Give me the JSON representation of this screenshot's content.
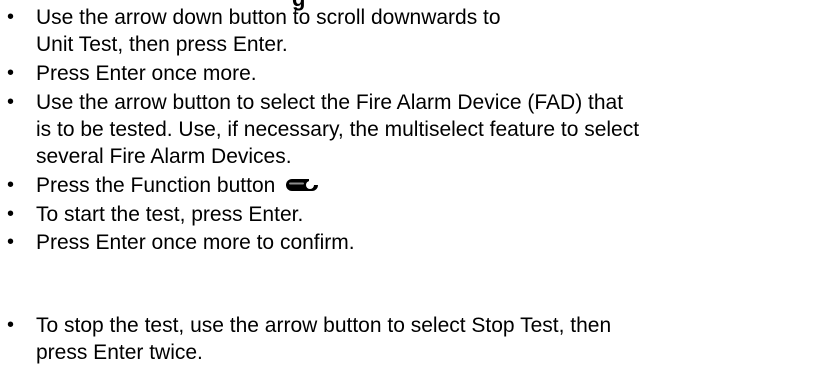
{
  "header_partial": "g",
  "steps": [
    {
      "lines": [
        "Use the arrow down button to scroll downwards to",
        "Unit Test, then press Enter."
      ]
    },
    {
      "lines": [
        "Press Enter once more."
      ]
    },
    {
      "lines": [
        "Use the arrow button to select  the Fire Alarm Device (FAD) that",
        "is to be tested. Use, if necessary, the multiselect feature to select",
        "several Fire Alarm Devices."
      ]
    },
    {
      "lines": [
        "Press the Function button"
      ],
      "icon": "wrench-key-icon"
    },
    {
      "lines": [
        "To start the test, press Enter."
      ]
    },
    {
      "lines": [
        "Press Enter once more to confirm."
      ]
    },
    {
      "lines": [
        "To stop the test, use the arrow button to select Stop Test, then",
        "press Enter twice."
      ]
    }
  ],
  "bullet_char": "•"
}
